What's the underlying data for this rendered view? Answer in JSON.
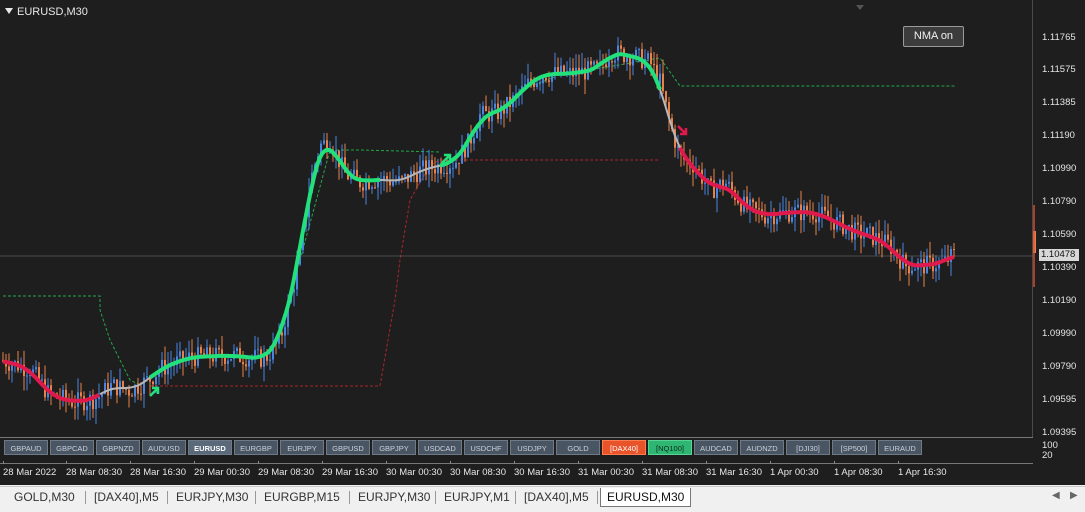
{
  "chart": {
    "symbol_title": "EURUSD,M30",
    "nma_button": "NMA on",
    "current_price": "1.10478",
    "price_labels": [
      "1.11765",
      "1.11575",
      "1.11385",
      "1.11190",
      "1.10990",
      "1.10790",
      "1.10590",
      "1.10390",
      "1.10190",
      "1.09990",
      "1.09790",
      "1.09595",
      "1.09395"
    ],
    "indicator_labels": [
      "100",
      "20"
    ],
    "time_labels": [
      "28 Mar 2022",
      "28 Mar 08:30",
      "28 Mar 16:30",
      "29 Mar 00:30",
      "29 Mar 08:30",
      "29 Mar 16:30",
      "30 Mar 00:30",
      "30 Mar 08:30",
      "30 Mar 16:30",
      "31 Mar 00:30",
      "31 Mar 08:30",
      "31 Mar 16:30",
      "1 Apr 00:30",
      "1 Apr 08:30",
      "1 Apr 16:30"
    ],
    "colors": {
      "bg": "#1e1e1e",
      "bull": "#4a86e0",
      "bear": "#e8824a",
      "nma_up": "#22e07a",
      "nma_down": "#e0194c",
      "nma_flat": "#b8b8b8",
      "signal_green": "#22a84a",
      "signal_red": "#a8262a"
    }
  },
  "symbol_buttons": [
    {
      "label": "GBPAUD",
      "state": "normal"
    },
    {
      "label": "GBPCAD",
      "state": "normal"
    },
    {
      "label": "GBPNZD",
      "state": "normal"
    },
    {
      "label": "AUDUSD",
      "state": "normal"
    },
    {
      "label": "EURUSD",
      "state": "active"
    },
    {
      "label": "EURGBP",
      "state": "normal"
    },
    {
      "label": "EURJPY",
      "state": "normal"
    },
    {
      "label": "GBPUSD",
      "state": "normal"
    },
    {
      "label": "GBPJPY",
      "state": "normal"
    },
    {
      "label": "USDCAD",
      "state": "normal"
    },
    {
      "label": "USDCHF",
      "state": "normal"
    },
    {
      "label": "USDJPY",
      "state": "normal"
    },
    {
      "label": "GOLD",
      "state": "normal"
    },
    {
      "label": "[DAX40]",
      "state": "red"
    },
    {
      "label": "[NQ100]",
      "state": "green"
    },
    {
      "label": "AUDCAD",
      "state": "normal"
    },
    {
      "label": "AUDNZD",
      "state": "normal"
    },
    {
      "label": "[DJI30]",
      "state": "normal"
    },
    {
      "label": "[SP500]",
      "state": "normal"
    },
    {
      "label": "EURAUD",
      "state": "normal"
    }
  ],
  "tabs": [
    "GOLD,M30",
    "[DAX40],M5",
    "EURJPY,M30",
    "EURGBP,M15",
    "EURJPY,M30",
    "EURJPY,M1",
    "[DAX40],M5",
    "EURUSD,M30"
  ],
  "active_tab": "EURUSD,M30"
}
